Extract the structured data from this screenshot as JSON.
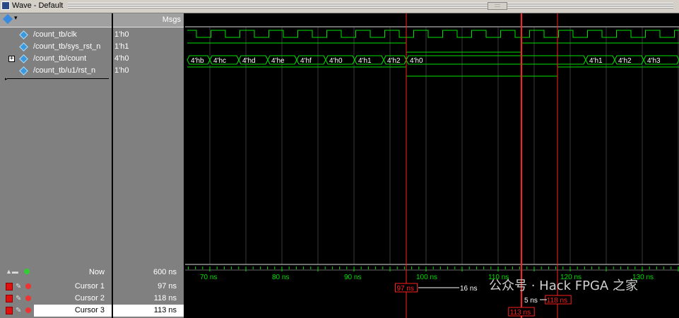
{
  "window": {
    "title": "Wave - Default"
  },
  "headers": {
    "msgs": "Msgs"
  },
  "signals": [
    {
      "name": "/count_tb/clk",
      "value": "1'h0"
    },
    {
      "name": "/count_tb/sys_rst_n",
      "value": "1'h1"
    },
    {
      "name": "/count_tb/count",
      "value": "4'h0"
    },
    {
      "name": "/count_tb/u1/rst_n",
      "value": "1'h0"
    }
  ],
  "count_segments": [
    "4'hb",
    "4'hc",
    "4'hd",
    "4'he",
    "4'hf",
    "4'h0",
    "4'h1",
    "4'h2",
    "4'h0",
    "4'h1",
    "4'h2",
    "4'h3"
  ],
  "timeline": {
    "labels": [
      "70 ns",
      "80 ns",
      "90 ns",
      "100 ns",
      "110 ns",
      "120 ns",
      "130 ns"
    ]
  },
  "now": {
    "label": "Now",
    "value": "600 ns"
  },
  "cursors": [
    {
      "label": "Cursor 1",
      "value": "97 ns",
      "marker": "97 ns"
    },
    {
      "label": "Cursor 2",
      "value": "118 ns",
      "marker": "118 ns"
    },
    {
      "label": "Cursor 3",
      "value": "113 ns",
      "marker": "113 ns"
    }
  ],
  "deltas": {
    "c1_c2": "16 ns",
    "c3_c2": "5 ns"
  },
  "watermark": "公众号 · Hack FPGA 之家",
  "colors": {
    "wave": "#00e000",
    "cursor": "#ff2020",
    "active_cursor": "#ff2020",
    "grid": "#3a3a3a"
  }
}
